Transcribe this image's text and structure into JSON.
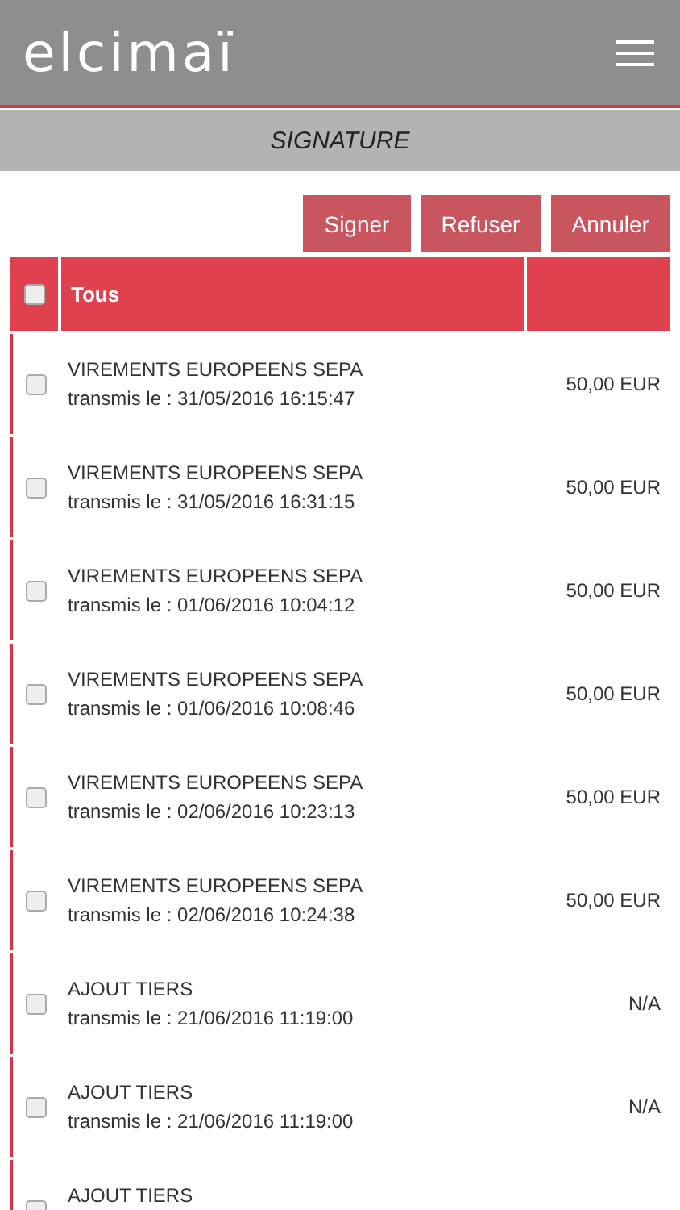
{
  "header": {
    "logo": "elcimaï"
  },
  "page_title": "SIGNATURE",
  "actions": [
    "Signer",
    "Refuser",
    "Annuler"
  ],
  "table": {
    "select_all": {
      "checked": false
    },
    "column_label": "Tous",
    "rows": [
      {
        "title": "VIREMENTS EUROPEENS SEPA",
        "date": "transmis le : 31/05/2016 16:15:47",
        "amount": "50,00 EUR",
        "checked": false
      },
      {
        "title": "VIREMENTS EUROPEENS SEPA",
        "date": "transmis le : 31/05/2016 16:31:15",
        "amount": "50,00 EUR",
        "checked": false
      },
      {
        "title": "VIREMENTS EUROPEENS SEPA",
        "date": "transmis le : 01/06/2016 10:04:12",
        "amount": "50,00 EUR",
        "checked": false
      },
      {
        "title": "VIREMENTS EUROPEENS SEPA",
        "date": "transmis le : 01/06/2016 10:08:46",
        "amount": "50,00 EUR",
        "checked": false
      },
      {
        "title": "VIREMENTS EUROPEENS SEPA",
        "date": "transmis le : 02/06/2016 10:23:13",
        "amount": "50,00 EUR",
        "checked": false
      },
      {
        "title": "VIREMENTS EUROPEENS SEPA",
        "date": "transmis le : 02/06/2016 10:24:38",
        "amount": "50,00 EUR",
        "checked": false
      },
      {
        "title": "AJOUT TIERS",
        "date": "transmis le : 21/06/2016 11:19:00",
        "amount": "N/A",
        "checked": false
      },
      {
        "title": "AJOUT TIERS",
        "date": "transmis le : 21/06/2016 11:19:00",
        "amount": "N/A",
        "checked": false
      },
      {
        "title": "AJOUT TIERS",
        "checked": false
      }
    ]
  }
}
